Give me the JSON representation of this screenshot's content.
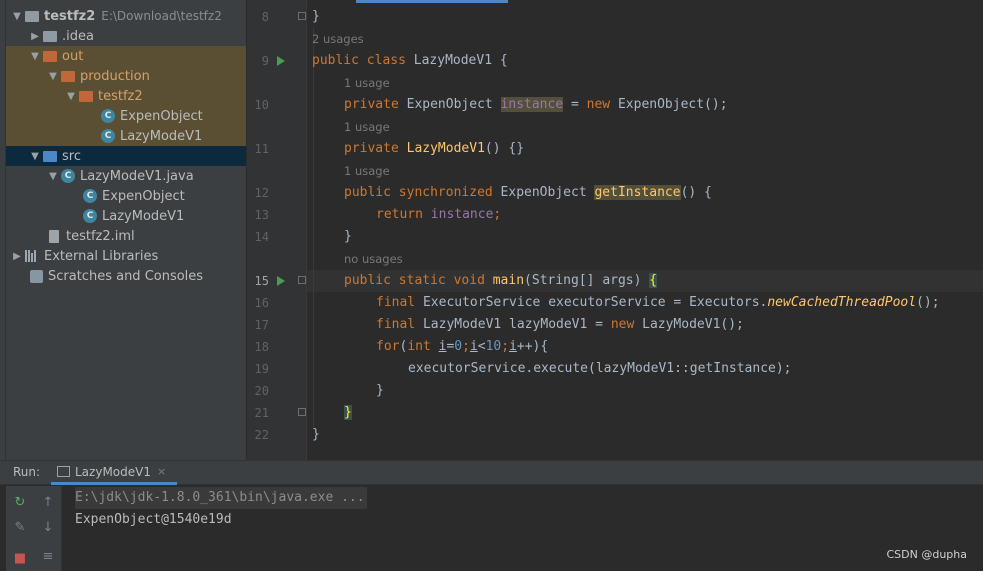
{
  "project_tree": {
    "root": {
      "label": "testfz2",
      "path": "E:\\Download\\testfz2"
    },
    "items": [
      {
        "label": ".idea"
      },
      {
        "label": "out"
      },
      {
        "label": "production"
      },
      {
        "label": "testfz2"
      },
      {
        "label": "ExpenObject"
      },
      {
        "label": "LazyModeV1"
      },
      {
        "label": "src"
      },
      {
        "label": "LazyModeV1.java"
      },
      {
        "label": "ExpenObject"
      },
      {
        "label": "LazyModeV1"
      },
      {
        "label": "testfz2.iml"
      },
      {
        "label": "External Libraries"
      },
      {
        "label": "Scratches and Consoles"
      }
    ]
  },
  "editor": {
    "line_numbers": [
      "8",
      "9",
      "10",
      "11",
      "12",
      "13",
      "14",
      "15",
      "16",
      "17",
      "18",
      "19",
      "20",
      "21",
      "22"
    ],
    "hints": {
      "h1": "2 usages",
      "h2": "1 usage",
      "h3": "1 usage",
      "h4": "1 usage",
      "h5": "no usages"
    },
    "code": {
      "l8_brace": "}",
      "l9_public": "public",
      "l9_class": "class",
      "l9_name": "LazyModeV1 {",
      "l10_private": "private",
      "l10_type": "ExpenObject",
      "l10_field": "instance",
      "l10_eq": " = ",
      "l10_new": "new",
      "l10_rest": "ExpenObject();",
      "l11_private": "private",
      "l11_ctor": "LazyModeV1",
      "l11_rest": "() {}",
      "l12_public": "public",
      "l12_sync": "synchronized",
      "l12_type": "ExpenObject",
      "l12_meth": "getInstance",
      "l12_rest": "() {",
      "l13_return": "return",
      "l13_field": "instance",
      "l13_semi": ";",
      "l14_brace": "}",
      "l15_public": "public",
      "l15_static": "static",
      "l15_void": "void",
      "l15_main": "main",
      "l15_args": "(String[] args) ",
      "l15_brace": "{",
      "l16_final": "final",
      "l16_decl": "ExecutorService executorService = Executors.",
      "l16_static": "newCachedThreadPool",
      "l16_rest": "();",
      "l17_final": "final",
      "l17_decl": "LazyModeV1 lazyModeV1 = ",
      "l17_new": "new",
      "l17_rest": "LazyModeV1();",
      "l18_for": "for",
      "l18_p1": "(",
      "l18_int": "int",
      "l18_i1": "i",
      "l18_eq": "=",
      "l18_n0": "0",
      "l18_semi1": ";",
      "l18_i2": "i",
      "l18_lt": "<",
      "l18_n10": "10",
      "l18_semi2": ";",
      "l18_i3": "i",
      "l18_rest": "++){",
      "l19_call": "executorService.execute(lazyModeV1::getInstance);",
      "l20_brace": "}",
      "l21_brace": "}",
      "l22_brace": "}"
    }
  },
  "run_panel": {
    "label": "Run:",
    "tab_label": "LazyModeV1",
    "tab_close": "×",
    "console": {
      "command": "E:\\jdk\\jdk-1.8.0_361\\bin\\java.exe ...",
      "output": "ExpenObject@1540e19d"
    }
  },
  "watermark": "CSDN @dupha",
  "colors": {
    "keyword": "#cc7832",
    "method": "#ffc66d",
    "field": "#9876aa",
    "number": "#6897bb",
    "text": "#a9b7c6",
    "selection": "#0d293e",
    "excluded_bg": "#5a4f33",
    "accent": "#4a88c7"
  }
}
